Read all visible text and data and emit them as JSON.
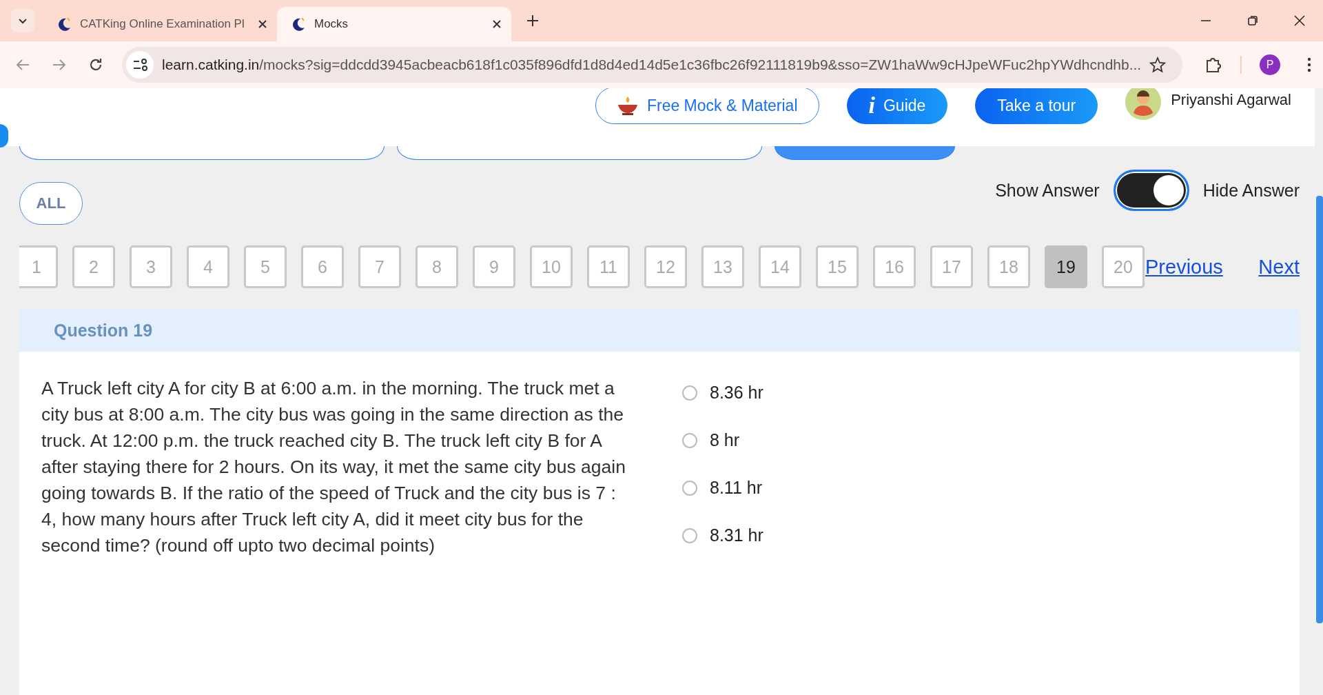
{
  "browser": {
    "tabs": [
      {
        "title": "CATKing Online Examination Pl",
        "selected": false
      },
      {
        "title": "Mocks",
        "selected": true
      }
    ],
    "url_host": "learn.catking.in",
    "url_path": "/mocks?sig=ddcdd3945acbeacb618f1c035f896dfd1d8d4ed14d5e1c36fbc26f92111819b9&sso=ZW1haWw9cHJpeWFuc2hpYWdhcndhb...",
    "profile_initial": "P"
  },
  "header": {
    "free_mock": "Free Mock & Material",
    "guide_icon": "i",
    "guide": "Guide",
    "tour": "Take a tour",
    "user": "Priyanshi Agarwal"
  },
  "section_pills": [
    {
      "selected": false
    },
    {
      "selected": false
    },
    {
      "selected": true
    }
  ],
  "filter": "ALL",
  "answer_toggle": {
    "show_label": "Show Answer",
    "hide_label": "Hide Answer",
    "on": true
  },
  "questions": [
    {
      "number": "1",
      "selected": false
    },
    {
      "number": "2",
      "selected": false
    },
    {
      "number": "3",
      "selected": false
    },
    {
      "number": "4",
      "selected": false
    },
    {
      "number": "5",
      "selected": false
    },
    {
      "number": "6",
      "selected": false
    },
    {
      "number": "7",
      "selected": false
    },
    {
      "number": "8",
      "selected": false
    },
    {
      "number": "9",
      "selected": false
    },
    {
      "number": "10",
      "selected": false
    },
    {
      "number": "11",
      "selected": false
    },
    {
      "number": "12",
      "selected": false
    },
    {
      "number": "13",
      "selected": false
    },
    {
      "number": "14",
      "selected": false
    },
    {
      "number": "15",
      "selected": false
    },
    {
      "number": "16",
      "selected": false
    },
    {
      "number": "17",
      "selected": false
    },
    {
      "number": "18",
      "selected": false
    },
    {
      "number": "19",
      "selected": true
    },
    {
      "number": "20",
      "selected": false
    }
  ],
  "previous": "Previous",
  "next": "Next",
  "question": {
    "title": "Question 19",
    "text": "A Truck left city A for city B at 6:00 a.m. in the morning. The truck met a city bus at 8:00 a.m. The city bus was going in the same direction as the truck. At 12:00 p.m. the truck reached city B. The truck left city B for A after staying there for 2 hours. On its way, it met the same city bus again going towards B. If the ratio of the speed of Truck and the city bus is 7 : 4, how many hours after Truck left city A, did it meet city bus for the second time? (round off upto two decimal points)",
    "options": [
      {
        "label": "8.36 hr",
        "selected": false
      },
      {
        "label": "8 hr",
        "selected": false
      },
      {
        "label": "8.11 hr",
        "selected": false
      },
      {
        "label": "8.31 hr",
        "selected": false
      }
    ]
  }
}
